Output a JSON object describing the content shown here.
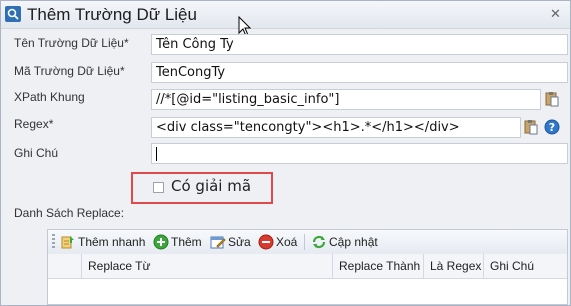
{
  "window": {
    "title": "Thêm Trường Dữ Liệu",
    "close_glyph": "✕"
  },
  "form": {
    "ten_truong": {
      "label": "Tên Trường Dữ Liệu*",
      "value": "Tên  Công Ty"
    },
    "ma_truong": {
      "label": "Mã Trường Dữ Liệu*",
      "value": "TenCongTy"
    },
    "xpath": {
      "label": "XPath Khung",
      "value": "//*[@id=\"listing_basic_info\"]"
    },
    "regex": {
      "label": "Regex*",
      "value": "<div class=\"tencongty\"><h1>.*</h1></div>"
    },
    "ghi_chu": {
      "label": "Ghi Chú",
      "value": ""
    },
    "co_giai_ma": {
      "label": "Có giải mã",
      "checked": false
    }
  },
  "replace_section": {
    "label": "Danh Sách Replace:",
    "toolbar": {
      "them_nhanh": "Thêm nhanh",
      "them": "Thêm",
      "sua": "Sửa",
      "xoa": "Xoá",
      "cap_nhat": "Cập nhật"
    },
    "columns": [
      "Replace Từ",
      "Replace Thành",
      "Là Regex",
      "Ghi Chú"
    ]
  },
  "icons": {
    "app": "search-window-icon",
    "paste": "paste-icon",
    "help": "help-icon",
    "quick_add": "quick-add-icon",
    "add": "add-icon",
    "edit": "edit-icon",
    "delete": "delete-icon",
    "refresh": "refresh-icon"
  },
  "colors": {
    "highlight_border": "#e04a4a",
    "add_green": "#3aa83a",
    "delete_red": "#d83a2e",
    "help_blue": "#2f77c9"
  }
}
